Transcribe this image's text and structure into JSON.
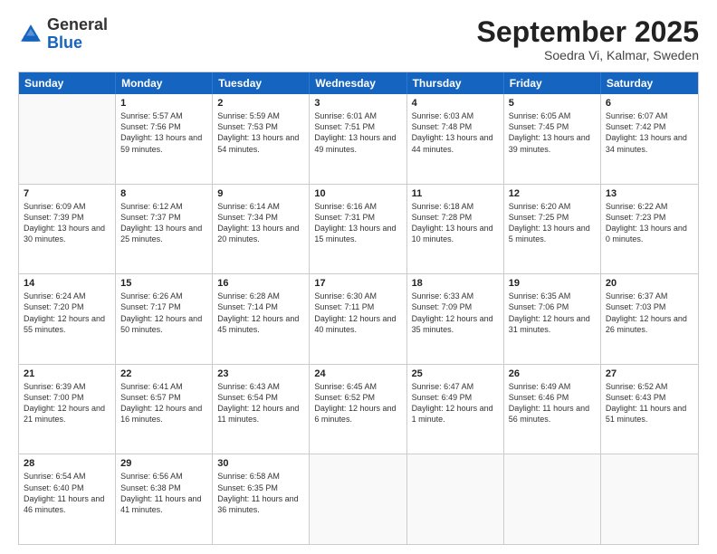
{
  "logo": {
    "general": "General",
    "blue": "Blue"
  },
  "title": "September 2025",
  "subtitle": "Soedra Vi, Kalmar, Sweden",
  "header_days": [
    "Sunday",
    "Monday",
    "Tuesday",
    "Wednesday",
    "Thursday",
    "Friday",
    "Saturday"
  ],
  "weeks": [
    [
      {
        "day": "",
        "empty": true
      },
      {
        "day": "1",
        "sunrise": "Sunrise: 5:57 AM",
        "sunset": "Sunset: 7:56 PM",
        "daylight": "Daylight: 13 hours and 59 minutes."
      },
      {
        "day": "2",
        "sunrise": "Sunrise: 5:59 AM",
        "sunset": "Sunset: 7:53 PM",
        "daylight": "Daylight: 13 hours and 54 minutes."
      },
      {
        "day": "3",
        "sunrise": "Sunrise: 6:01 AM",
        "sunset": "Sunset: 7:51 PM",
        "daylight": "Daylight: 13 hours and 49 minutes."
      },
      {
        "day": "4",
        "sunrise": "Sunrise: 6:03 AM",
        "sunset": "Sunset: 7:48 PM",
        "daylight": "Daylight: 13 hours and 44 minutes."
      },
      {
        "day": "5",
        "sunrise": "Sunrise: 6:05 AM",
        "sunset": "Sunset: 7:45 PM",
        "daylight": "Daylight: 13 hours and 39 minutes."
      },
      {
        "day": "6",
        "sunrise": "Sunrise: 6:07 AM",
        "sunset": "Sunset: 7:42 PM",
        "daylight": "Daylight: 13 hours and 34 minutes."
      }
    ],
    [
      {
        "day": "7",
        "sunrise": "Sunrise: 6:09 AM",
        "sunset": "Sunset: 7:39 PM",
        "daylight": "Daylight: 13 hours and 30 minutes."
      },
      {
        "day": "8",
        "sunrise": "Sunrise: 6:12 AM",
        "sunset": "Sunset: 7:37 PM",
        "daylight": "Daylight: 13 hours and 25 minutes."
      },
      {
        "day": "9",
        "sunrise": "Sunrise: 6:14 AM",
        "sunset": "Sunset: 7:34 PM",
        "daylight": "Daylight: 13 hours and 20 minutes."
      },
      {
        "day": "10",
        "sunrise": "Sunrise: 6:16 AM",
        "sunset": "Sunset: 7:31 PM",
        "daylight": "Daylight: 13 hours and 15 minutes."
      },
      {
        "day": "11",
        "sunrise": "Sunrise: 6:18 AM",
        "sunset": "Sunset: 7:28 PM",
        "daylight": "Daylight: 13 hours and 10 minutes."
      },
      {
        "day": "12",
        "sunrise": "Sunrise: 6:20 AM",
        "sunset": "Sunset: 7:25 PM",
        "daylight": "Daylight: 13 hours and 5 minutes."
      },
      {
        "day": "13",
        "sunrise": "Sunrise: 6:22 AM",
        "sunset": "Sunset: 7:23 PM",
        "daylight": "Daylight: 13 hours and 0 minutes."
      }
    ],
    [
      {
        "day": "14",
        "sunrise": "Sunrise: 6:24 AM",
        "sunset": "Sunset: 7:20 PM",
        "daylight": "Daylight: 12 hours and 55 minutes."
      },
      {
        "day": "15",
        "sunrise": "Sunrise: 6:26 AM",
        "sunset": "Sunset: 7:17 PM",
        "daylight": "Daylight: 12 hours and 50 minutes."
      },
      {
        "day": "16",
        "sunrise": "Sunrise: 6:28 AM",
        "sunset": "Sunset: 7:14 PM",
        "daylight": "Daylight: 12 hours and 45 minutes."
      },
      {
        "day": "17",
        "sunrise": "Sunrise: 6:30 AM",
        "sunset": "Sunset: 7:11 PM",
        "daylight": "Daylight: 12 hours and 40 minutes."
      },
      {
        "day": "18",
        "sunrise": "Sunrise: 6:33 AM",
        "sunset": "Sunset: 7:09 PM",
        "daylight": "Daylight: 12 hours and 35 minutes."
      },
      {
        "day": "19",
        "sunrise": "Sunrise: 6:35 AM",
        "sunset": "Sunset: 7:06 PM",
        "daylight": "Daylight: 12 hours and 31 minutes."
      },
      {
        "day": "20",
        "sunrise": "Sunrise: 6:37 AM",
        "sunset": "Sunset: 7:03 PM",
        "daylight": "Daylight: 12 hours and 26 minutes."
      }
    ],
    [
      {
        "day": "21",
        "sunrise": "Sunrise: 6:39 AM",
        "sunset": "Sunset: 7:00 PM",
        "daylight": "Daylight: 12 hours and 21 minutes."
      },
      {
        "day": "22",
        "sunrise": "Sunrise: 6:41 AM",
        "sunset": "Sunset: 6:57 PM",
        "daylight": "Daylight: 12 hours and 16 minutes."
      },
      {
        "day": "23",
        "sunrise": "Sunrise: 6:43 AM",
        "sunset": "Sunset: 6:54 PM",
        "daylight": "Daylight: 12 hours and 11 minutes."
      },
      {
        "day": "24",
        "sunrise": "Sunrise: 6:45 AM",
        "sunset": "Sunset: 6:52 PM",
        "daylight": "Daylight: 12 hours and 6 minutes."
      },
      {
        "day": "25",
        "sunrise": "Sunrise: 6:47 AM",
        "sunset": "Sunset: 6:49 PM",
        "daylight": "Daylight: 12 hours and 1 minute."
      },
      {
        "day": "26",
        "sunrise": "Sunrise: 6:49 AM",
        "sunset": "Sunset: 6:46 PM",
        "daylight": "Daylight: 11 hours and 56 minutes."
      },
      {
        "day": "27",
        "sunrise": "Sunrise: 6:52 AM",
        "sunset": "Sunset: 6:43 PM",
        "daylight": "Daylight: 11 hours and 51 minutes."
      }
    ],
    [
      {
        "day": "28",
        "sunrise": "Sunrise: 6:54 AM",
        "sunset": "Sunset: 6:40 PM",
        "daylight": "Daylight: 11 hours and 46 minutes."
      },
      {
        "day": "29",
        "sunrise": "Sunrise: 6:56 AM",
        "sunset": "Sunset: 6:38 PM",
        "daylight": "Daylight: 11 hours and 41 minutes."
      },
      {
        "day": "30",
        "sunrise": "Sunrise: 6:58 AM",
        "sunset": "Sunset: 6:35 PM",
        "daylight": "Daylight: 11 hours and 36 minutes."
      },
      {
        "day": "",
        "empty": true
      },
      {
        "day": "",
        "empty": true
      },
      {
        "day": "",
        "empty": true
      },
      {
        "day": "",
        "empty": true
      }
    ]
  ]
}
